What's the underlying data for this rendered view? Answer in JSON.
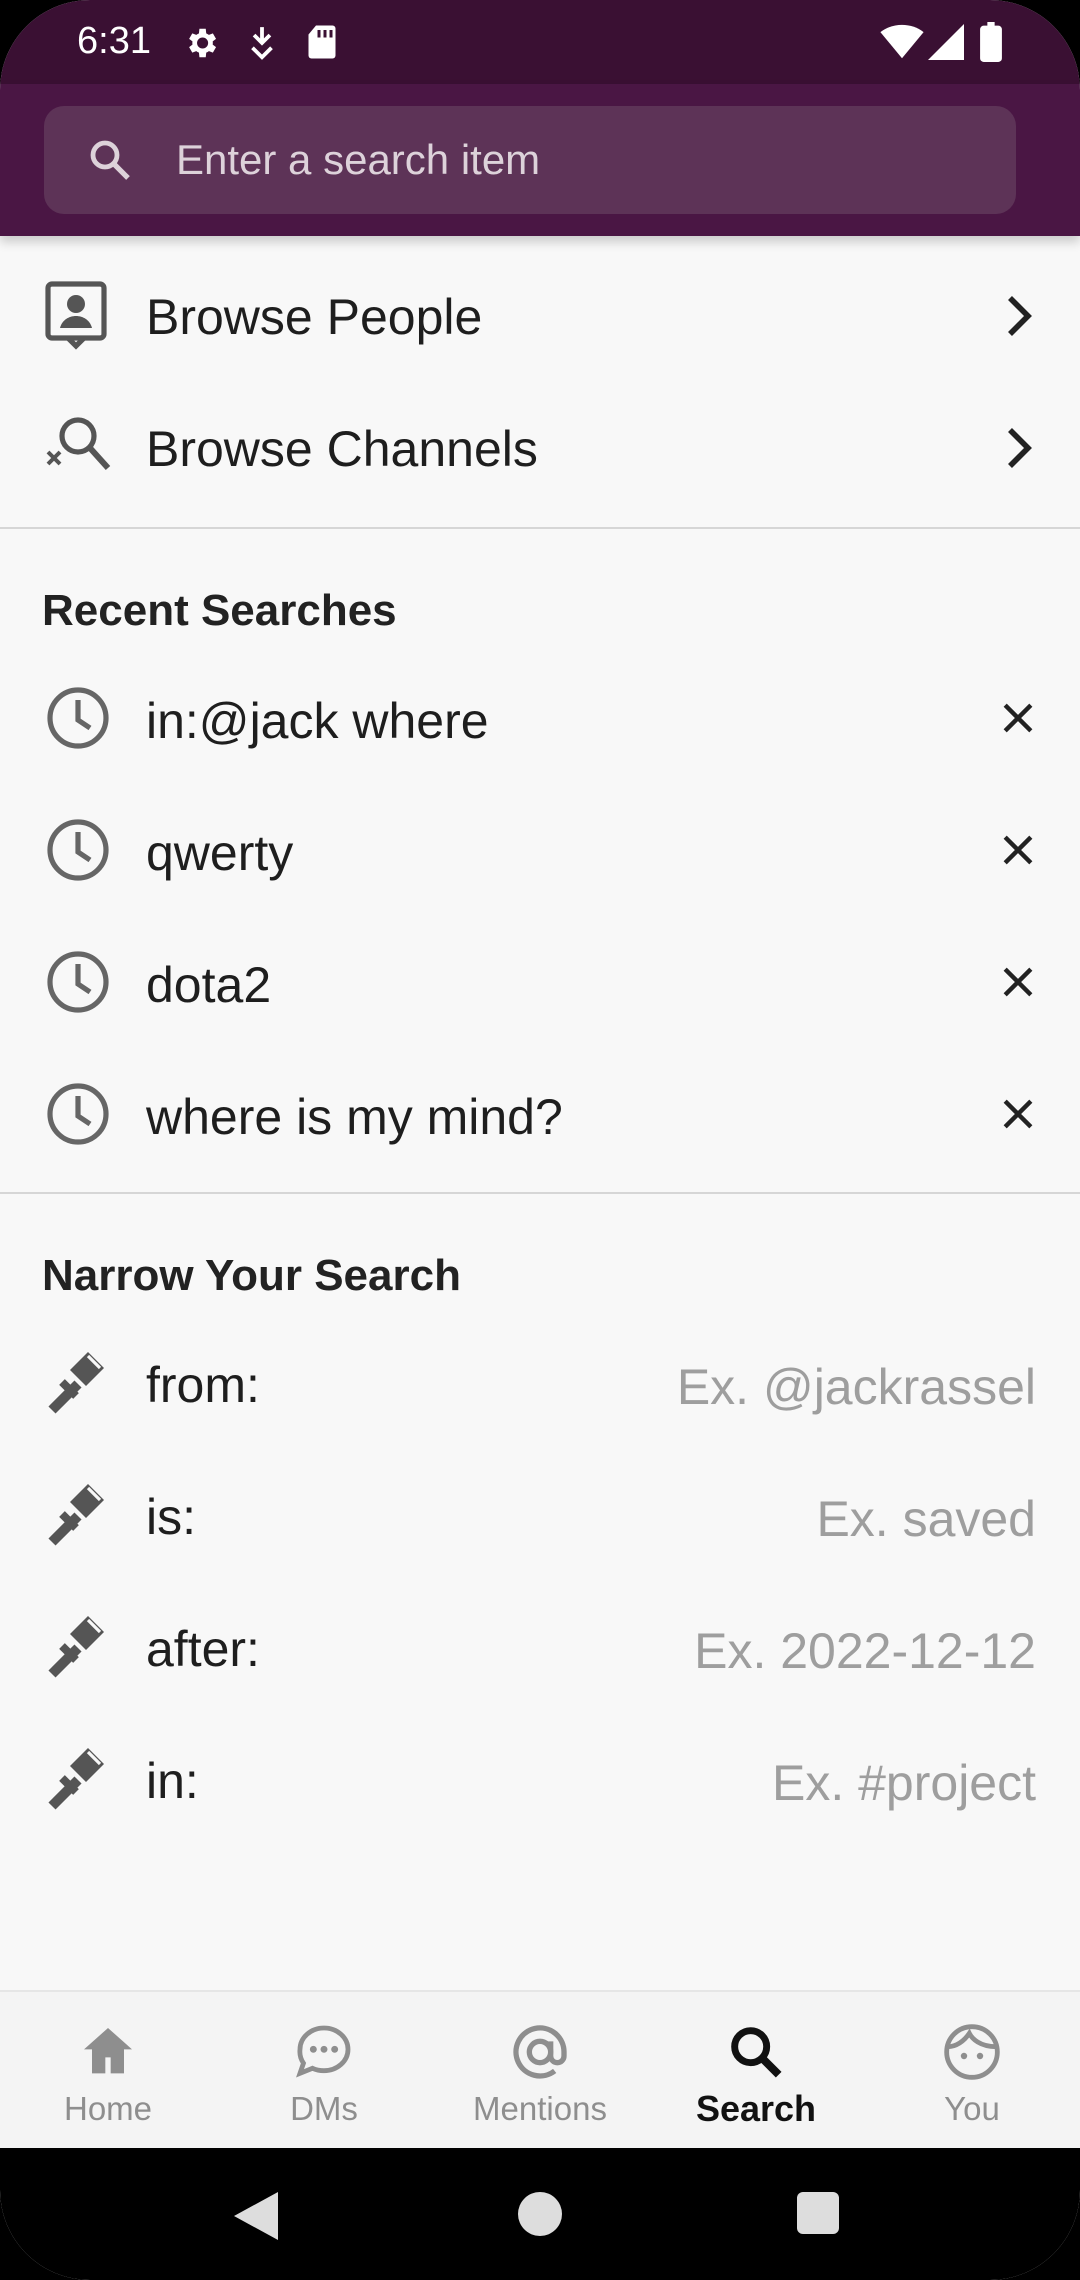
{
  "status_bar": {
    "time": "6:31"
  },
  "search": {
    "placeholder": "Enter a search item"
  },
  "browse": {
    "people_label": "Browse People",
    "channels_label": "Browse Channels"
  },
  "recent": {
    "title": "Recent Searches",
    "items": [
      {
        "label": "in:@jack where"
      },
      {
        "label": "qwerty"
      },
      {
        "label": "dota2"
      },
      {
        "label": "where is my mind?"
      }
    ]
  },
  "narrow": {
    "title": "Narrow Your Search",
    "filters": [
      {
        "label": "from:",
        "hint": "Ex. @jackrassel"
      },
      {
        "label": "is:",
        "hint": "Ex. saved"
      },
      {
        "label": "after:",
        "hint": "Ex. 2022-12-12"
      },
      {
        "label": "in:",
        "hint": "Ex. #project"
      }
    ]
  },
  "nav": {
    "tabs": [
      {
        "label": "Home",
        "icon": "home-icon"
      },
      {
        "label": "DMs",
        "icon": "chat-bubble-icon"
      },
      {
        "label": "Mentions",
        "icon": "at-sign-icon"
      },
      {
        "label": "Search",
        "icon": "search-icon",
        "active": true
      },
      {
        "label": "You",
        "icon": "user-face-icon"
      }
    ]
  },
  "colors": {
    "status_bar": "#3a1033",
    "header": "#4a1644",
    "search_box": "#5d3357",
    "hint_text": "#9e9e9e"
  }
}
